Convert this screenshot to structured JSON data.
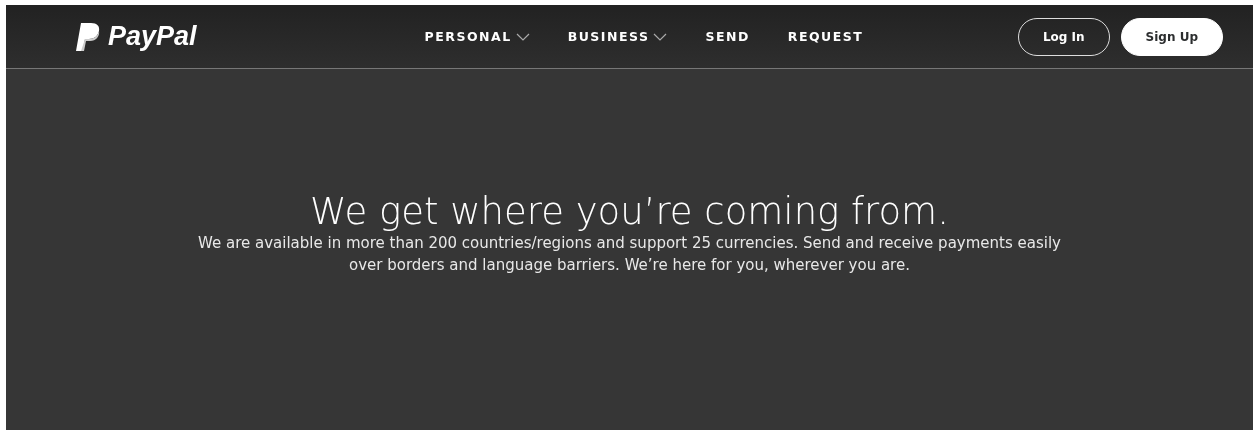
{
  "header": {
    "logo": "PayPal",
    "nav": [
      {
        "label": "PERSONAL",
        "dropdown": true
      },
      {
        "label": "BUSINESS",
        "dropdown": true
      },
      {
        "label": "SEND",
        "dropdown": false
      },
      {
        "label": "REQUEST",
        "dropdown": false
      }
    ],
    "buttons": [
      {
        "label": "Log In",
        "kind": "outline"
      },
      {
        "label": "Sign Up",
        "kind": "solid"
      }
    ]
  },
  "hero": {
    "title": "We get where you’re coming from.",
    "text": "We are available in more than 200 countries/regions and support 25 currencies. Send and receive payments easily over borders and language barriers. We’re here for you, wherever you are."
  }
}
